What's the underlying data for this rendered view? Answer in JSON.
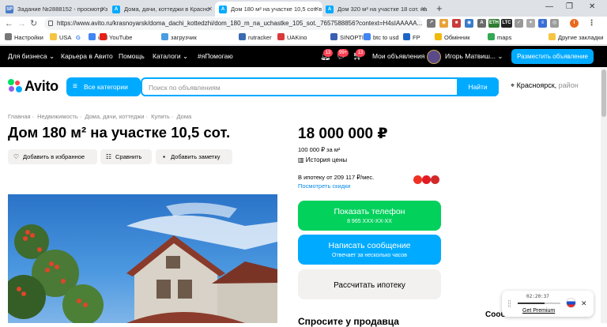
{
  "browser": {
    "tabs": [
      {
        "label": "Задание №2888152 - просмотр з",
        "favicon": "SP",
        "color": "#4a7cc9",
        "active": false
      },
      {
        "label": "Дома, дачи, коттеджи в Красно",
        "favicon": "A",
        "color": "#00aaff",
        "active": false
      },
      {
        "label": "Дом 180 м² на участке 10,5 сот. в",
        "favicon": "A",
        "color": "#00aaff",
        "active": true
      },
      {
        "label": "Дом 320 м² на участке 18 сот. на",
        "favicon": "A",
        "color": "#00aaff",
        "active": false
      }
    ],
    "new_tab": "+",
    "url": "https://www.avito.ru/krasnoyarsk/doma_dachi_kottedzhi/dom_180_m_na_uchastke_105_sot._7657588856?context=H4sIAAAAA...",
    "bookmarks": [
      "Настройки",
      "USA",
      "G",
      "usd",
      "YouTube",
      "загрузчик",
      "rutracker",
      "UAKino",
      "SINOPTIK",
      "btc to usd",
      "FP",
      "Обмінник",
      "maps",
      "Другие закладки"
    ],
    "ext_ltc": "LTC",
    "ext_eth": "ETH"
  },
  "topnav": {
    "business": "Для бизнеса",
    "career": "Карьера в Авито",
    "help": "Помощь",
    "catalogs": "Каталоги",
    "help_hashtag": "#яПомогаю",
    "badge_favorites": "13",
    "badge_messages": "99+",
    "badge_cart": "13",
    "my_ads": "Мои объявления",
    "user_name": "Игорь Матвиш...",
    "post_ad": "Разместить объявление"
  },
  "header": {
    "logo": "Avito",
    "all_categories": "Все категории",
    "search_placeholder": "Поиск по объявлениям",
    "find": "Найти",
    "city": "Красноярск,",
    "district": "район"
  },
  "listing": {
    "breadcrumbs": [
      "Главная",
      "Недвижимость",
      "Дома, дачи, коттеджи",
      "Купить",
      "Дома"
    ],
    "title": "Дом 180 м² на участке 10,5 сот.",
    "add_favorite": "Добавить в избранное",
    "compare": "Сравнить",
    "add_note": "Добавить заметку",
    "price": "18 000 000 ₽",
    "price_per_m2": "100 000 ₽ за м²",
    "price_history": "История цены",
    "mortgage_text": "В ипотеку от 209 117 ₽/мес.",
    "see_discounts": "Посмотреть скидки",
    "show_phone": "Показать телефон",
    "phone_masked": "8 965 XXX-XX-XX",
    "write_message": "Написать сообщение",
    "reply_time": "Отвечает за несколько часов",
    "calc_mortgage": "Рассчитать ипотеку",
    "ask_seller": "Спросите у продавца"
  },
  "popup": {
    "time": "02:20:37",
    "get_premium": "Get Premium",
    "partial_text": "Сооб"
  },
  "colors": {
    "avito_blue": "#00aaff",
    "avito_green": "#02d15c",
    "nav_black": "#000000"
  }
}
